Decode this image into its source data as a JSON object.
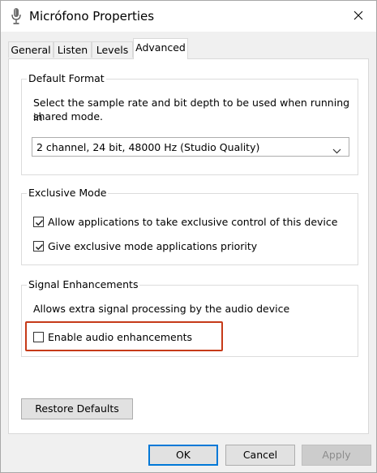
{
  "window": {
    "title": "Micrófono Properties",
    "close_icon": "close-icon",
    "app_icon": "microphone-icon"
  },
  "tabs": [
    {
      "label": "General"
    },
    {
      "label": "Listen"
    },
    {
      "label": "Levels"
    },
    {
      "label": "Advanced",
      "active": true
    }
  ],
  "default_format": {
    "group_label": "Default Format",
    "description_line1": "Select the sample rate and bit depth to be used when running in",
    "description_line2": "shared mode.",
    "selected_format": "2 channel, 24 bit, 48000 Hz (Studio Quality)"
  },
  "exclusive_mode": {
    "group_label": "Exclusive Mode",
    "allow_exclusive_label": "Allow applications to take exclusive control of this device",
    "allow_exclusive_checked": true,
    "priority_label": "Give exclusive mode applications priority",
    "priority_checked": true
  },
  "signal_enhancements": {
    "group_label": "Signal Enhancements",
    "description": "Allows extra signal processing by the audio device",
    "enable_label": "Enable audio enhancements",
    "enable_checked": false,
    "highlight_color": "#c63a18"
  },
  "buttons": {
    "restore_defaults": "Restore Defaults",
    "ok": "OK",
    "cancel": "Cancel",
    "apply": "Apply",
    "apply_enabled": false
  },
  "colors": {
    "accent": "#0078d7",
    "window_bg": "#f0f0f0",
    "panel_bg": "#ffffff"
  }
}
